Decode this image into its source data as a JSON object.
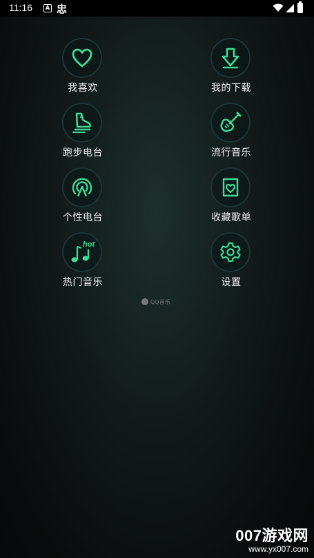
{
  "status_bar": {
    "time": "11:16",
    "notif_a": "A",
    "notif_char": "忠"
  },
  "menu": [
    {
      "label": "我喜欢",
      "icon": "heart-icon"
    },
    {
      "label": "我的下载",
      "icon": "download-icon"
    },
    {
      "label": "跑步电台",
      "icon": "running-shoe-icon"
    },
    {
      "label": "流行音乐",
      "icon": "guitar-icon"
    },
    {
      "label": "个性电台",
      "icon": "radio-broadcast-icon"
    },
    {
      "label": "收藏歌单",
      "icon": "favorite-playlist-icon"
    },
    {
      "label": "热门音乐",
      "icon": "hot-music-icon",
      "badge": "hot"
    },
    {
      "label": "设置",
      "icon": "gear-icon"
    }
  ],
  "brand": "QQ音乐",
  "watermark": {
    "title": "007游戏网",
    "url": "www.yx007.com"
  },
  "colors": {
    "accent": "#3ddc97",
    "circle_border": "#1c3436"
  }
}
